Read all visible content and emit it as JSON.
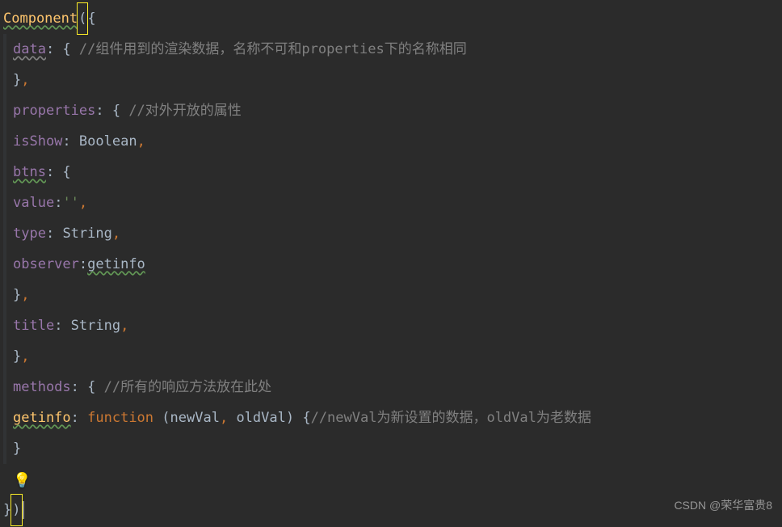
{
  "code": {
    "component": "Component",
    "data_key": "data",
    "data_comment": "//组件用到的渲染数据，名称不可和properties下的名称相同",
    "properties_key": "properties",
    "properties_comment": "//对外开放的属性",
    "isShow_key": "isShow",
    "isShow_type": "Boolean",
    "btns_key": "btns",
    "value_key": "value",
    "value_val": "''",
    "type_key": "type",
    "type_val": "String",
    "observer_key": "observer",
    "observer_val": "getinfo",
    "title_key": "title",
    "title_val": "String",
    "methods_key": "methods",
    "methods_comment": "//所有的响应方法放在此处",
    "getinfo_key": "getinfo",
    "function_kw": "function",
    "newVal": "newVal",
    "oldVal": "oldVal",
    "method_comment": "//newVal为新设置的数据，oldVal为老数据"
  },
  "watermark": "CSDN @荣华富贵8",
  "bulb_icon": "💡"
}
